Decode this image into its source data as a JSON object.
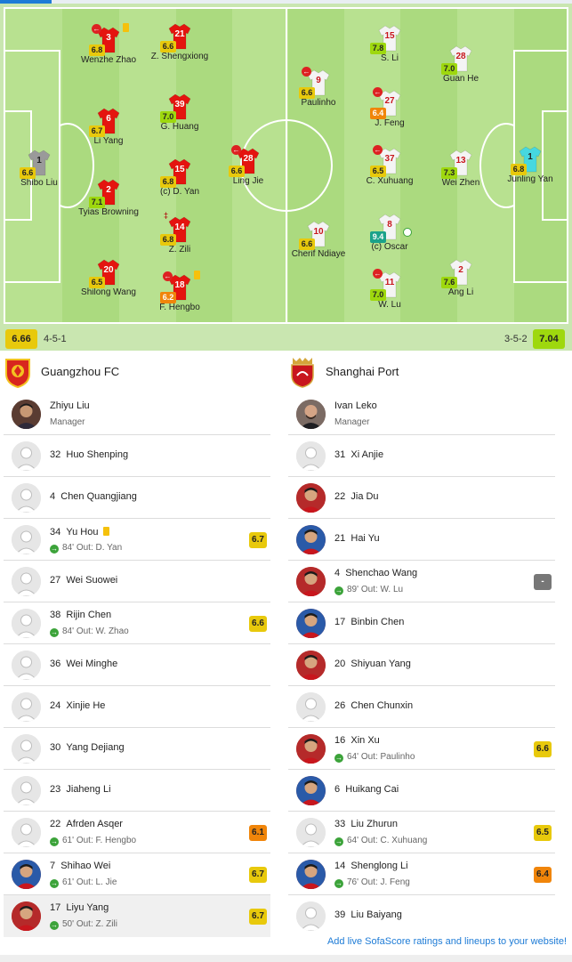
{
  "home": {
    "name": "Guangzhou FC",
    "formation": "4-5-1",
    "team_rating": "6.66",
    "manager": {
      "name": "Zhiyu Liu",
      "role": "Manager"
    },
    "players": [
      {
        "num": "1",
        "name": "Shibo Liu",
        "rating": "6.6"
      },
      {
        "num": "3",
        "name": "Wenzhe Zhao",
        "rating": "6.8"
      },
      {
        "num": "6",
        "name": "Li Yang",
        "rating": "6.7"
      },
      {
        "num": "2",
        "name": "Tyias Browning",
        "rating": "7.1"
      },
      {
        "num": "20",
        "name": "Shilong Wang",
        "rating": "6.5"
      },
      {
        "num": "21",
        "name": "Z. Shengxiong",
        "rating": "6.6"
      },
      {
        "num": "39",
        "name": "G. Huang",
        "rating": "7.0"
      },
      {
        "num": "15",
        "name": "(c) D. Yan",
        "rating": "6.8"
      },
      {
        "num": "14",
        "name": "Z. Zili",
        "rating": "6.8"
      },
      {
        "num": "18",
        "name": "F. Hengbo",
        "rating": "6.2"
      },
      {
        "num": "28",
        "name": "Ling Jie",
        "rating": "6.6"
      }
    ],
    "subs": [
      {
        "num": "32",
        "name": "Huo Shenping"
      },
      {
        "num": "4",
        "name": "Chen Quangjiang"
      },
      {
        "num": "34",
        "name": "Yu Hou",
        "minute": "84'",
        "out": "Out: D. Yan",
        "rating": "6.7"
      },
      {
        "num": "27",
        "name": "Wei Suowei"
      },
      {
        "num": "38",
        "name": "Rijin Chen",
        "minute": "84'",
        "out": "Out: W. Zhao",
        "rating": "6.6"
      },
      {
        "num": "36",
        "name": "Wei Minghe"
      },
      {
        "num": "24",
        "name": "Xinjie He"
      },
      {
        "num": "30",
        "name": "Yang Dejiang"
      },
      {
        "num": "23",
        "name": "Jiaheng Li"
      },
      {
        "num": "22",
        "name": "Afrden Asqer",
        "minute": "61'",
        "out": "Out: F. Hengbo",
        "rating": "6.1"
      },
      {
        "num": "7",
        "name": "Shihao Wei",
        "minute": "61'",
        "out": "Out: L. Jie",
        "rating": "6.7"
      },
      {
        "num": "17",
        "name": "Liyu Yang",
        "minute": "50'",
        "out": "Out: Z. Zili",
        "rating": "6.7"
      }
    ]
  },
  "away": {
    "name": "Shanghai Port",
    "formation": "3-5-2",
    "team_rating": "7.04",
    "manager": {
      "name": "Ivan Leko",
      "role": "Manager"
    },
    "players": [
      {
        "num": "9",
        "name": "Paulinho",
        "rating": "6.6"
      },
      {
        "num": "10",
        "name": "Cherif Ndiaye",
        "rating": "6.6"
      },
      {
        "num": "15",
        "name": "S. Li",
        "rating": "7.8"
      },
      {
        "num": "27",
        "name": "J. Feng",
        "rating": "6.4"
      },
      {
        "num": "37",
        "name": "C. Xuhuang",
        "rating": "6.5"
      },
      {
        "num": "8",
        "name": "(c) Oscar",
        "rating": "9.4"
      },
      {
        "num": "11",
        "name": "W. Lu",
        "rating": "7.0"
      },
      {
        "num": "28",
        "name": "Guan He",
        "rating": "7.0"
      },
      {
        "num": "13",
        "name": "Wei Zhen",
        "rating": "7.3"
      },
      {
        "num": "2",
        "name": "Ang Li",
        "rating": "7.6"
      },
      {
        "num": "1",
        "name": "Junling Yan",
        "rating": "6.8"
      }
    ],
    "subs": [
      {
        "num": "31",
        "name": "Xi Anjie"
      },
      {
        "num": "22",
        "name": "Jia Du"
      },
      {
        "num": "21",
        "name": "Hai Yu"
      },
      {
        "num": "4",
        "name": "Shenchao Wang",
        "minute": "89'",
        "out": "Out: W. Lu",
        "rating": "-"
      },
      {
        "num": "17",
        "name": "Binbin Chen"
      },
      {
        "num": "20",
        "name": "Shiyuan Yang"
      },
      {
        "num": "26",
        "name": "Chen Chunxin"
      },
      {
        "num": "16",
        "name": "Xin Xu",
        "minute": "64'",
        "out": "Out: Paulinho",
        "rating": "6.6"
      },
      {
        "num": "6",
        "name": "Huikang Cai"
      },
      {
        "num": "33",
        "name": "Liu Zhurun",
        "minute": "64'",
        "out": "Out: C. Xuhuang",
        "rating": "6.5"
      },
      {
        "num": "14",
        "name": "Shenglong Li",
        "minute": "76'",
        "out": "Out: J. Feng",
        "rating": "6.4"
      },
      {
        "num": "39",
        "name": "Liu Baiyang"
      }
    ]
  },
  "footer": {
    "link": "Add live SofaScore ratings and lineups to your website!"
  },
  "colors": {
    "home_shirt": "#e4140f",
    "away_shirt": "#f4f4f4",
    "home_gk": "#9a9a9a",
    "away_gk": "#46d8e0",
    "pitch_light": "#b6e08e",
    "pitch_dark": "#a8d67d"
  }
}
